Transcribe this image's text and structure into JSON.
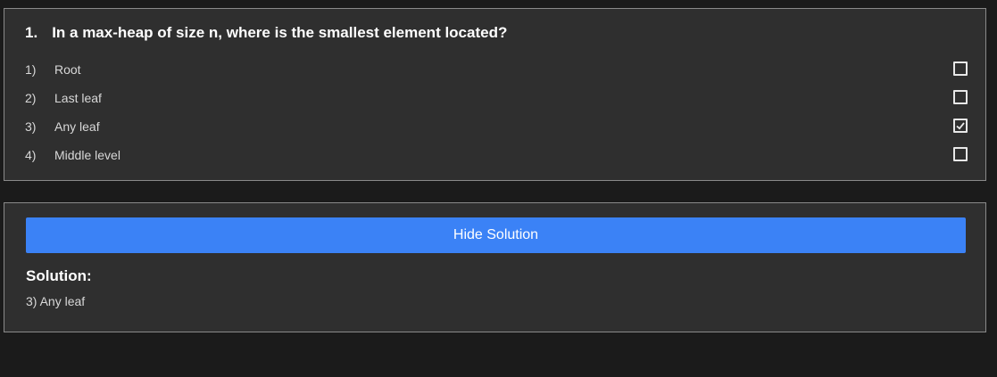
{
  "question": {
    "number": "1.",
    "text": "In a max-heap of size n, where is the smallest element located?",
    "options": [
      {
        "num": "1)",
        "label": "Root",
        "checked": false
      },
      {
        "num": "2)",
        "label": "Last leaf",
        "checked": false
      },
      {
        "num": "3)",
        "label": "Any leaf",
        "checked": true
      },
      {
        "num": "4)",
        "label": "Middle level",
        "checked": false
      }
    ]
  },
  "solution": {
    "button_label": "Hide Solution",
    "heading": "Solution:",
    "answer": "3) Any leaf"
  },
  "colors": {
    "background": "#1b1b1b",
    "card": "#2f2f2f",
    "button": "#3b82f6"
  }
}
